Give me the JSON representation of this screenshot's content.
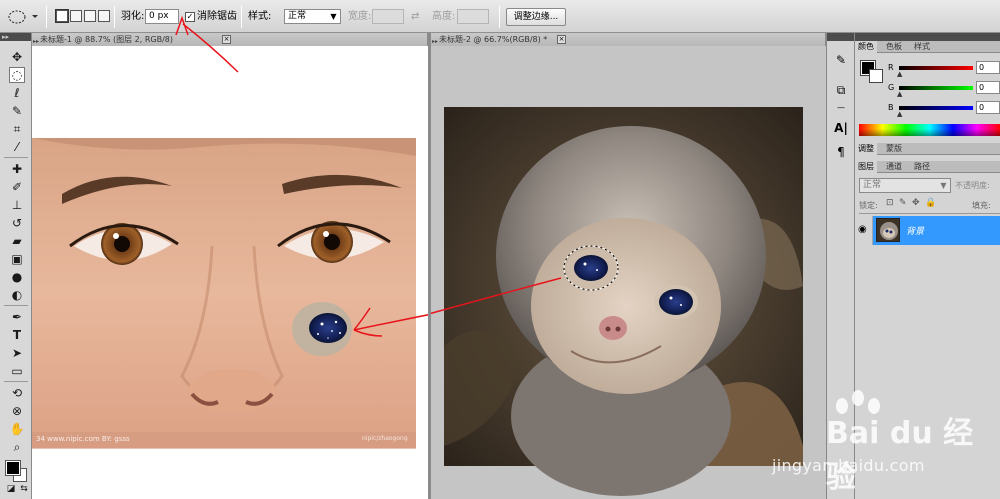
{
  "options": {
    "feather_label": "羽化:",
    "feather_value": "0 px",
    "antialias_label": "消除锯齿",
    "antialias_checked": "✓",
    "style_label": "样式:",
    "style_value": "正常",
    "width_label": "宽度:",
    "height_label": "高度:",
    "refine_edge_label": "调整边缘..."
  },
  "documents": [
    {
      "tab": "未标题-1 @ 88.7% (图层 2, RGB/8)",
      "close": "×"
    },
    {
      "tab": "未标题-2 @ 66.7%(RGB/8) *",
      "close": "×"
    }
  ],
  "photo1": {
    "footer_text": "34 www.nipic.com BY: gsss",
    "footer_right": "nipic/zhaogong"
  },
  "panels": {
    "color_tabs": [
      "颜色",
      "色板",
      "样式"
    ],
    "sliders": [
      {
        "letter": "R",
        "value": "0"
      },
      {
        "letter": "G",
        "value": "0"
      },
      {
        "letter": "B",
        "value": "0"
      }
    ],
    "adjust_tabs": [
      "调整",
      "蒙版"
    ],
    "layer_tabs": [
      "图层",
      "通道",
      "路径"
    ],
    "blend_mode": "正常",
    "opacity_label": "不透明度:",
    "lock_label": "锁定:",
    "fill_label": "填充:",
    "layer_name": "背景"
  },
  "watermark": {
    "brand": "Bai du 经验",
    "url": "jingyan.baidu.com"
  },
  "colors": {
    "selection_blue": "#3399ff",
    "annotation_red": "#e8141b"
  }
}
